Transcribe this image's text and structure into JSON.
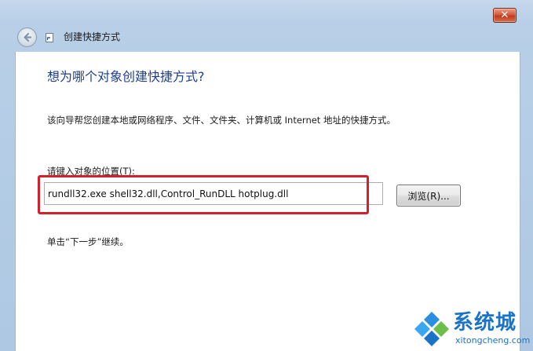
{
  "window": {
    "title": "创建快捷方式",
    "close_glyph": "✕",
    "accent_color": "#1e3f8f",
    "highlight_color": "#d3202a"
  },
  "icons": {
    "back": "back-arrow-icon",
    "app": "shortcut-icon",
    "close": "close-icon"
  },
  "main": {
    "heading": "想为哪个对象创建快捷方式?",
    "description": "该向导帮您创建本地或网络程序、文件、文件夹、计算机或 Internet 地址的快捷方式。",
    "location_label": "请键入对象的位置(T):",
    "location_value": "rundll32.exe shell32.dll,Control_RunDLL hotplug.dll",
    "browse_label": "浏览(R)...",
    "continue_hint": "单击“下一步”继续。"
  },
  "watermark": {
    "name": "系统城",
    "domain": "xitongcheng.com"
  }
}
